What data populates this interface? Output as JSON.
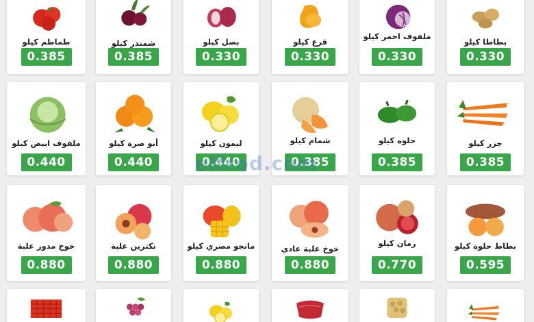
{
  "products": [
    {
      "name": "طماطم كيلو",
      "price": "0.385",
      "icon": "tomato-icon"
    },
    {
      "name": "شمندر كيلو",
      "price": "0.385",
      "icon": "beetroot-icon"
    },
    {
      "name": "بصل كيلو",
      "price": "0.330",
      "icon": "onion-icon"
    },
    {
      "name": "قرع كيلو",
      "price": "0.330",
      "icon": "pumpkin-icon"
    },
    {
      "name": "ملفوف احمر كيلو",
      "price": "0.330",
      "icon": "red-cabbage-icon"
    },
    {
      "name": "بطاطا كيلو",
      "price": "0.330",
      "icon": "potato-icon"
    },
    {
      "name": "ملفوف ابيض كيلو",
      "price": "0.440",
      "icon": "white-cabbage-icon"
    },
    {
      "name": "أبو صرة كيلو",
      "price": "0.440",
      "icon": "orange-icon"
    },
    {
      "name": "ليمون كيلو",
      "price": "0.440",
      "icon": "lemon-icon"
    },
    {
      "name": "شمام كيلو",
      "price": "0.385",
      "icon": "melon-icon"
    },
    {
      "name": "حلوه كيلو",
      "price": "0.385",
      "icon": "green-pepper-icon"
    },
    {
      "name": "جزر كيلو",
      "price": "0.385",
      "icon": "carrot-icon"
    },
    {
      "name": "خوخ مدور علبة",
      "price": "0.880",
      "icon": "peach-icon"
    },
    {
      "name": "نكترين علبة",
      "price": "0.880",
      "icon": "nectarine-icon"
    },
    {
      "name": "مانجو مصري كيلو",
      "price": "0.880",
      "icon": "mango-icon"
    },
    {
      "name": "خوخ علبة عادي",
      "price": "0.880",
      "icon": "peach-box-icon"
    },
    {
      "name": "رمان كيلو",
      "price": "0.770",
      "icon": "pomegranate-icon"
    },
    {
      "name": "بطاط حلوة كيلو",
      "price": "0.595",
      "icon": "sweet-potato-icon"
    },
    {
      "name": "",
      "price": "",
      "icon": "strawberry-box-icon"
    },
    {
      "name": "",
      "price": "",
      "icon": "grapes-icon"
    },
    {
      "name": "",
      "price": "",
      "icon": "lemon-icon"
    },
    {
      "name": "",
      "price": "",
      "icon": "meat-icon"
    },
    {
      "name": "",
      "price": "",
      "icon": "baby-potato-icon"
    },
    {
      "name": "",
      "price": "",
      "icon": "carrot-icon"
    }
  ],
  "watermark": "elfrod.com",
  "colors": {
    "price_bg": "#3aa64a",
    "card_bg": "#ffffff",
    "page_bg": "#eeeeee"
  }
}
